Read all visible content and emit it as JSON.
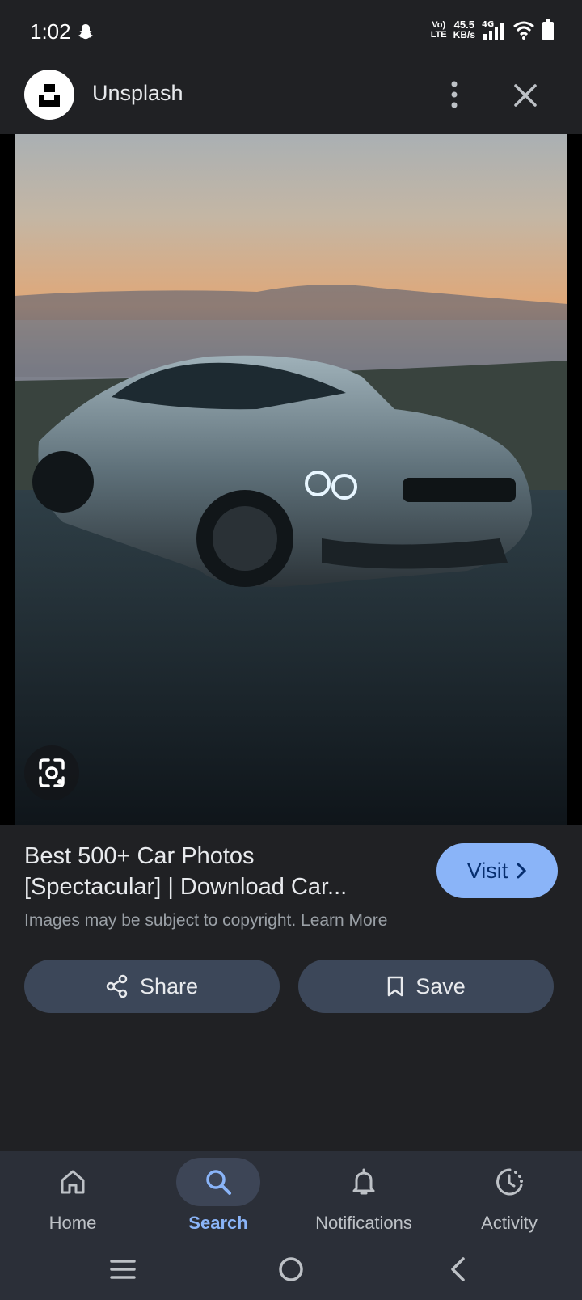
{
  "status_bar": {
    "time": "1:02",
    "net_tag_top": "Vo)",
    "net_tag_bottom": "LTE",
    "speed_value": "45.5",
    "speed_unit": "KB/s",
    "network": "4G"
  },
  "header": {
    "site_name": "Unsplash"
  },
  "result": {
    "title_line1": "Best 500+ Car Photos",
    "title_line2": "[Spectacular] | Download Car...",
    "visit_label": "Visit",
    "copyright_text": "Images may be subject to copyright.",
    "learn_more": "Learn More",
    "share_label": "Share",
    "save_label": "Save"
  },
  "bottom_nav": {
    "items": [
      {
        "label": "Home",
        "icon": "home-icon"
      },
      {
        "label": "Search",
        "icon": "search-icon",
        "active": true
      },
      {
        "label": "Notifications",
        "icon": "bell-icon"
      },
      {
        "label": "Activity",
        "icon": "activity-icon"
      }
    ]
  },
  "colors": {
    "background": "#202124",
    "accent": "#8ab4f8",
    "button_bg": "#3c4759",
    "nav_bg": "#2b2f38"
  }
}
